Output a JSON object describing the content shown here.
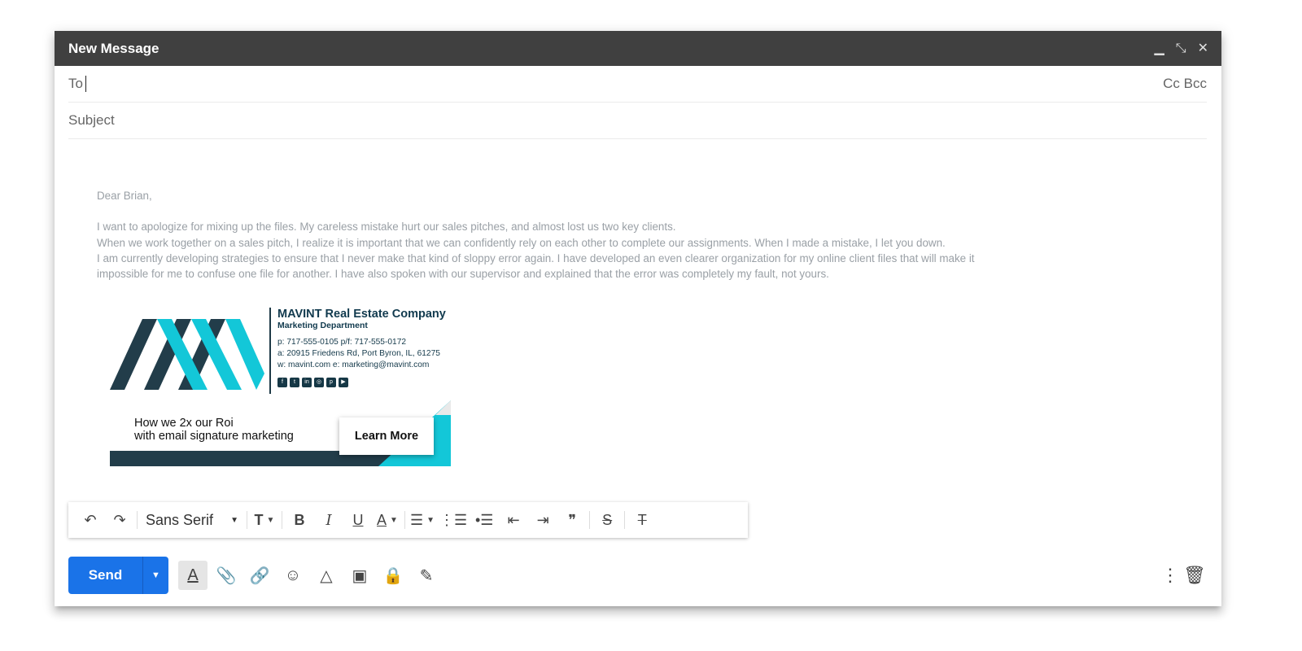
{
  "window": {
    "title": "New Message"
  },
  "fields": {
    "to_label": "To",
    "cc_bcc": "Cc Bcc",
    "subject_placeholder": "Subject"
  },
  "body": {
    "greeting": "Dear Brian,",
    "lines": [
      "I want to apologize for mixing up the files. My careless mistake hurt our sales pitches, and almost lost us two key clients.",
      "When we work together on a sales pitch, I realize it is important that we can confidently rely on each other to complete our assignments. When I made a mistake, I let you down.",
      "I am currently developing strategies to ensure that I never make that kind of sloppy error again. I have developed an even clearer organization for my online client files that will make it",
      "impossible for me to confuse one file for another. I have also spoken with our supervisor and explained that the error was completely my fault, not yours."
    ]
  },
  "signature": {
    "company": "MAVINT Real Estate Company",
    "department": "Marketing Department",
    "phone_line": "p: 717-555-0105 p/f: 717-555-0172",
    "address_line": "a: 20915 Friedens Rd, Port Byron, IL, 61275",
    "web_line": "w: mavint.com e: marketing@mavint.com",
    "banner_line1": "How we 2x our Roi",
    "banner_line2": "with email signature marketing",
    "cta": "Learn More",
    "colors": {
      "dark": "#223d4a",
      "accent": "#13c7d8"
    }
  },
  "format_toolbar": {
    "font": "Sans Serif"
  },
  "bottom_bar": {
    "send": "Send",
    "accent": "#1a73e8"
  }
}
